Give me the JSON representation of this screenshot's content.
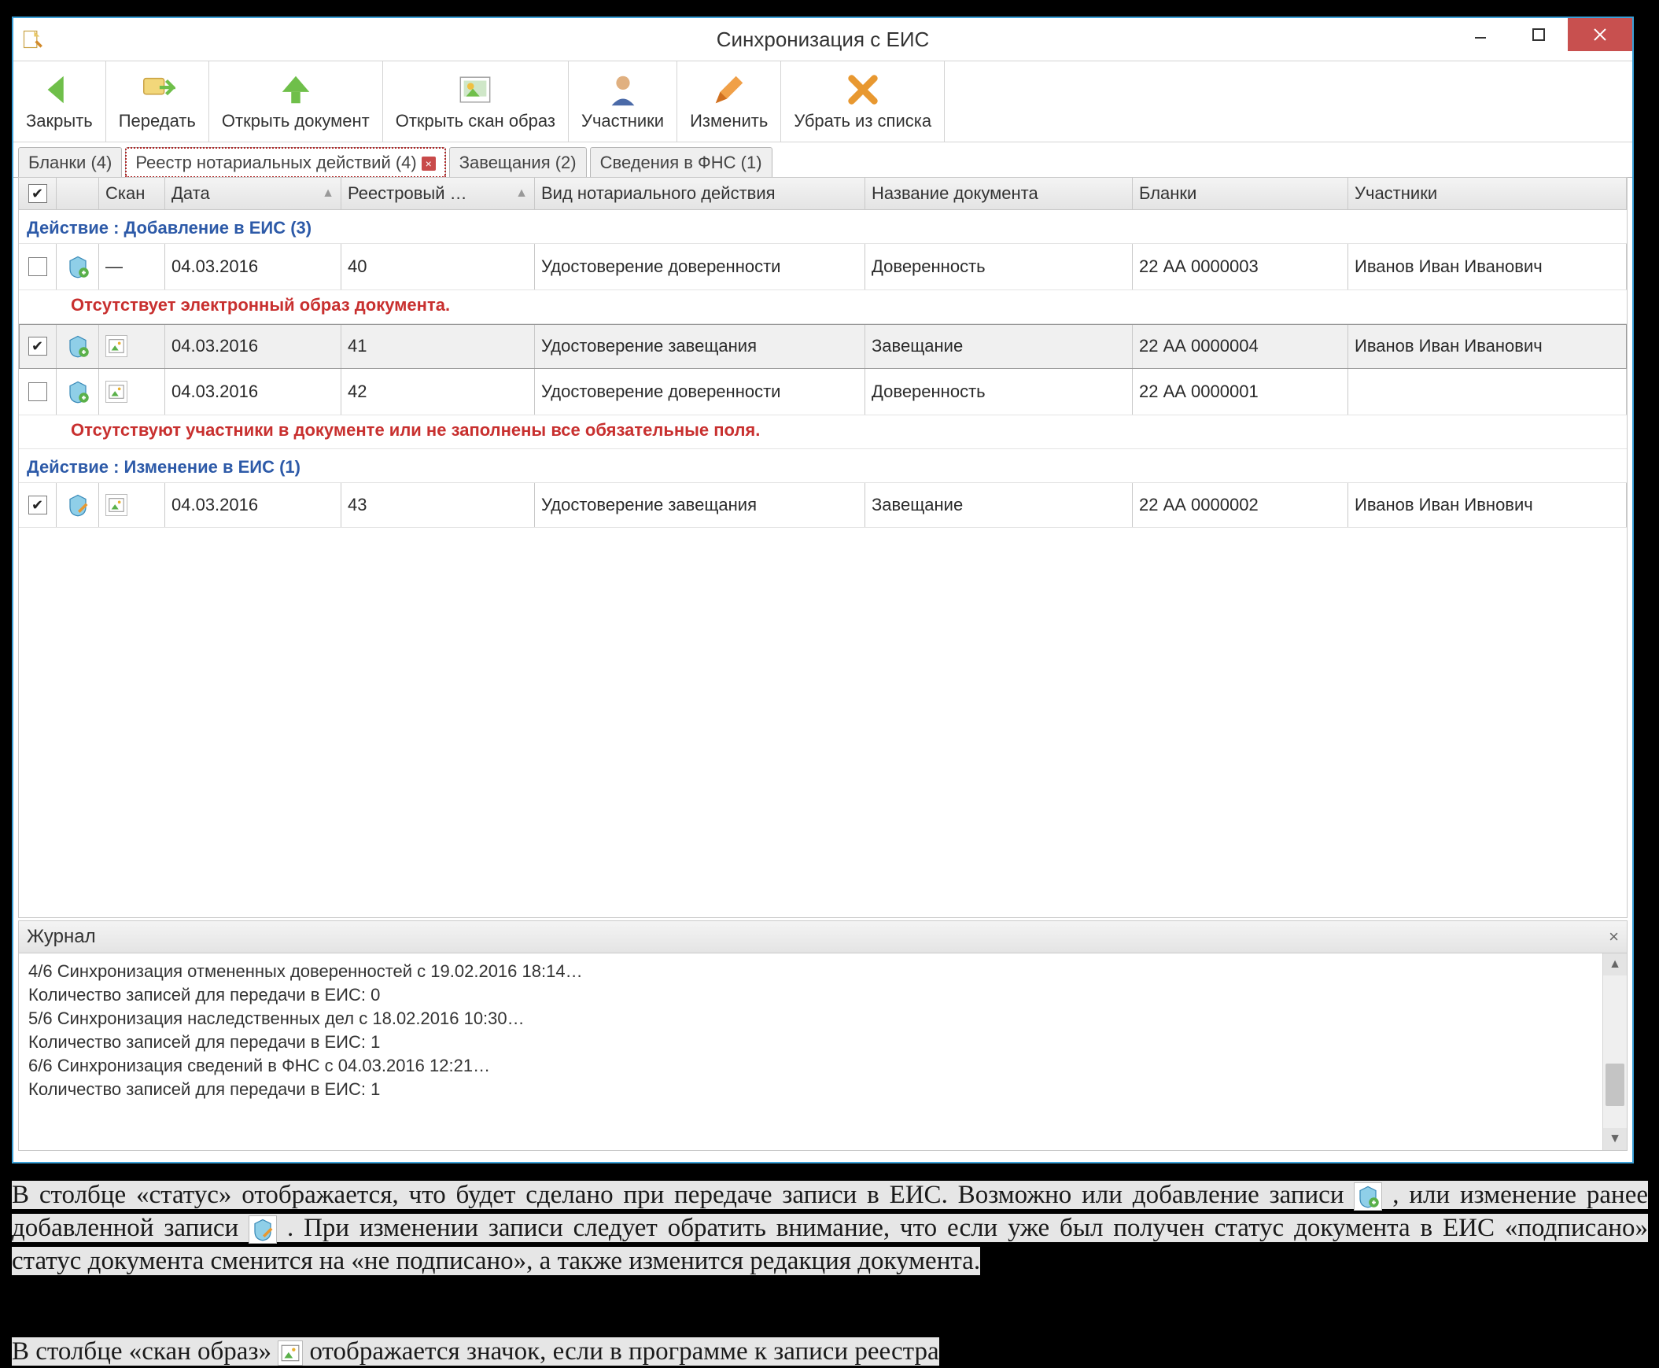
{
  "window": {
    "title": "Синхронизация с ЕИС"
  },
  "toolbar": {
    "close": "Закрыть",
    "send": "Передать",
    "open_doc": "Открыть документ",
    "open_scan": "Открыть скан образ",
    "participants": "Участники",
    "edit": "Изменить",
    "remove": "Убрать из списка"
  },
  "tabs": {
    "t0": "Бланки (4)",
    "t1": "Реестр нотариальных действий (4)",
    "t2": "Завещания (2)",
    "t3": "Сведения в ФНС (1)"
  },
  "columns": {
    "scan": "Скан",
    "date": "Дата",
    "reg": "Реестровый …",
    "type": "Вид нотариального действия",
    "doc": "Название документа",
    "blanks": "Бланки",
    "participants": "Участники"
  },
  "groups": {
    "g0": "Действие : Добавление в ЕИС (3)",
    "g1": "Действие : Изменение в ЕИС (1)"
  },
  "rows": {
    "r0": {
      "scan": "—",
      "date": "04.03.2016",
      "reg": "40",
      "type": "Удостоверение доверенности",
      "doc": "Доверенность",
      "blank": "22 АА 0000003",
      "part": "Иванов Иван Иванович"
    },
    "r1": {
      "date": "04.03.2016",
      "reg": "41",
      "type": "Удостоверение завещания",
      "doc": "Завещание",
      "blank": "22 АА 0000004",
      "part": "Иванов Иван Иванович"
    },
    "r2": {
      "date": "04.03.2016",
      "reg": "42",
      "type": "Удостоверение доверенности",
      "doc": "Доверенность",
      "blank": "22 АА 0000001",
      "part": ""
    },
    "r3": {
      "date": "04.03.2016",
      "reg": "43",
      "type": "Удостоверение завещания",
      "doc": "Завещание",
      "blank": "22 АА 0000002",
      "part": "Иванов Иван Ивнович"
    }
  },
  "errors": {
    "e0": "Отсутствует электронный образ документа.",
    "e1": "Отсутствуют участники в документе или не заполнены все обязательные поля."
  },
  "journal": {
    "title": "Журнал",
    "l0": "4/6 Синхронизация отмененных доверенностей с 19.02.2016 18:14…",
    "l1": "  Количество записей для передачи в ЕИС: 0",
    "l2": "5/6 Синхронизация наследственных дел с 18.02.2016 10:30…",
    "l3": "  Количество записей для передачи в ЕИС: 1",
    "l4": "6/6 Синхронизация сведений в ФНС с 04.03.2016 12:21…",
    "l5": "  Количество записей для передачи в ЕИС: 1"
  },
  "bodytext": {
    "p1a": "В столбце «статус» отображается, что будет сделано при передаче записи в ЕИС. Возможно или добавление записи ",
    "p1b": " , или изменение ранее добавленной записи ",
    "p1c": ". При изменении записи следует обратить внимание, что если уже был получен статус документа в ЕИС «подписано» статус документа сменится на «не подписано», а также изменится редакция документа.",
    "p2a": "В столбце «скан образ» ",
    "p2b": " отображается значок, если в программе к записи реестра"
  }
}
